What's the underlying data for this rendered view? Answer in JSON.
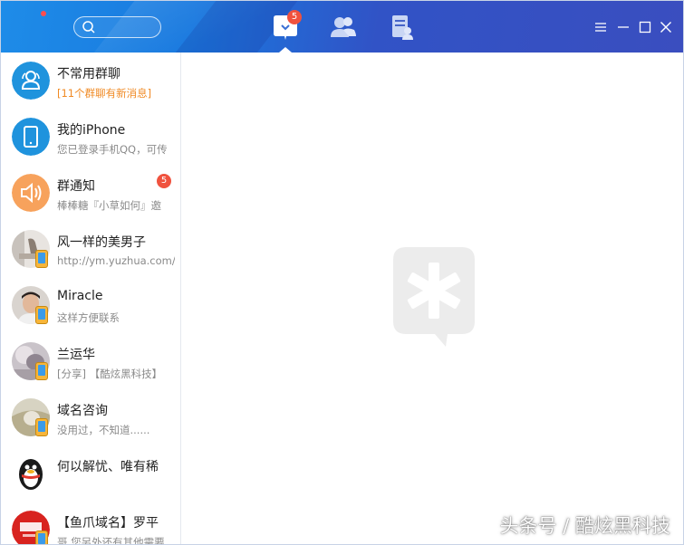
{
  "header": {
    "tabs": [
      {
        "name": "messages",
        "icon": "chat-bubble-icon",
        "badge": "5",
        "active": true
      },
      {
        "name": "contacts",
        "icon": "contacts-icon",
        "badge": ""
      },
      {
        "name": "space",
        "icon": "document-user-icon",
        "badge": ""
      }
    ],
    "colors": {
      "gradient_start": "#1e8ce8",
      "gradient_end": "#3a4ebf",
      "badge": "#f0523e"
    }
  },
  "conversations": [
    {
      "name": "不常用群聊",
      "preview": "[11个群聊有新消息]",
      "preview_style": "orange",
      "avatar": "group-folder-icon",
      "badge": ""
    },
    {
      "name": "我的iPhone",
      "preview": "您已登录手机QQ，可传",
      "avatar": "phone-icon",
      "badge": ""
    },
    {
      "name": "群通知",
      "preview": "棒棒糖『小草如何』邀",
      "avatar": "speaker-icon",
      "badge": "5"
    },
    {
      "name": "风一样的美男子",
      "preview": "http://ym.yuzhua.com/go",
      "avatar": "user-photo",
      "badge": ""
    },
    {
      "name": "Miracle",
      "preview": "这样方便联系",
      "avatar": "user-photo",
      "badge": ""
    },
    {
      "name": "兰运华",
      "preview": "[分享] 【酷炫黑科技】",
      "avatar": "user-photo",
      "badge": ""
    },
    {
      "name": "域名咨询",
      "preview": "没用过，不知道......",
      "avatar": "user-photo",
      "badge": ""
    },
    {
      "name": "何以解忧、唯有稀",
      "preview": "",
      "avatar": "penguin-icon",
      "badge": ""
    },
    {
      "name": "【鱼爪域名】罗平",
      "preview": "哥 您另外还有其他需要",
      "avatar": "yuzhua-logo",
      "badge": ""
    }
  ],
  "watermark": "头条号 / 酷炫黑科技"
}
